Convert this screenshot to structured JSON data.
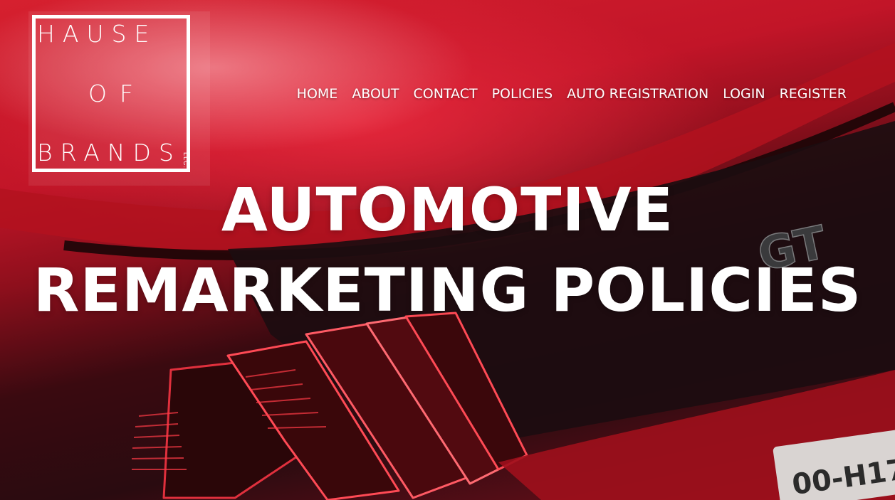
{
  "logo": {
    "line1": "HAUSE",
    "line2": "OF",
    "line3": "BRANDS",
    "suffix": "LLC."
  },
  "nav": {
    "items": [
      {
        "label": "HOME"
      },
      {
        "label": "ABOUT"
      },
      {
        "label": "CONTACT"
      },
      {
        "label": "POLICIES"
      },
      {
        "label": "AUTO REGISTRATION"
      },
      {
        "label": "LOGIN"
      },
      {
        "label": "REGISTER"
      }
    ]
  },
  "hero": {
    "title_line1": "AUTOMOTIVE",
    "title_line2": "REMARKETING POLICIES",
    "background": "red-car-rear-photo",
    "badge": "GT",
    "plate_partial": "00-H17"
  },
  "colors": {
    "text": "#ffffff",
    "car_red": "#c21528",
    "dark": "#2a0b10"
  }
}
